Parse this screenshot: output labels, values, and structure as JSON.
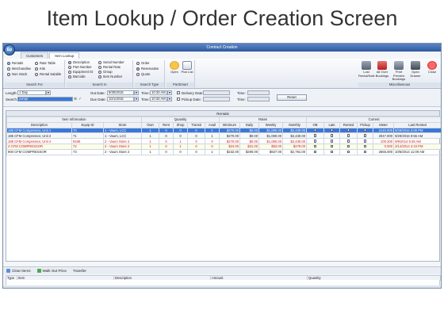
{
  "slide_title": "Item Lookup / Order Creation Screen",
  "window": {
    "title": "Contract Creation",
    "logo": "Ep"
  },
  "tabs": [
    {
      "label": "Customers"
    },
    {
      "label": "Item Lookup"
    }
  ],
  "ribbon": {
    "search_for": {
      "title": "Search For",
      "options": [
        "Rentals",
        "Merchandise",
        "Non Stock",
        "Rate Table",
        "Kits",
        "Rental Salable"
      ],
      "selected": "Rentals"
    },
    "search_in": {
      "title": "Search In",
      "options": [
        "Description",
        "Part Number",
        "Equipment ID",
        "Barcode",
        "Serial Number",
        "Rental Rate",
        "Group",
        "Item Number"
      ],
      "selected": "Description"
    },
    "search_type": {
      "title": "Search Type",
      "options": [
        "Order",
        "Reservation",
        "Quote"
      ],
      "selected": "Reservation"
    },
    "part_smart": {
      "title": "PartSmart",
      "buttons": [
        "Open",
        "Pick List"
      ]
    },
    "misc": {
      "title": "Miscellaneous",
      "buttons": [
        "Lost Rental/Sale",
        "All Over Bookings",
        "Print Preview Bookings",
        "Open Drawer",
        "Close"
      ]
    }
  },
  "form": {
    "length_label": "Length:",
    "length_value": "1 Day",
    "search_label": "Search:",
    "search_value": "compr",
    "out_date_label": "Out Date:",
    "out_date_value": "9/30/2015",
    "due_date_label": "Due Date:",
    "due_date_value": "10/1/2015",
    "time_label": "Time:",
    "out_time": "10:33 AM",
    "due_time": "10:33 AM",
    "delivery_label": "Delivery Date:",
    "pickup_label": "Pickup Date:",
    "reset_label": "Reset"
  },
  "grid": {
    "caption": "Rentals",
    "group_headers": [
      "Item Information",
      "Quantity",
      "Rates",
      "Current"
    ],
    "columns": [
      "Description",
      "Equip ID",
      "Store",
      "Own",
      "Rent",
      "Shop",
      "Transit",
      "Avail",
      "Minimum",
      "Daily",
      "Weekly",
      "Monthly",
      "OB",
      "Late",
      "Rented",
      "Pickup",
      "Meter",
      "Last Rented"
    ],
    "rows": [
      {
        "cells": [
          "185 CFM Compressor, Unit 1",
          "70",
          "1 - Vaum, LCC",
          "1",
          "0",
          "0",
          "0",
          "1",
          "$270.00",
          "$0.00",
          "$1,080.00",
          "$2,430.00",
          "",
          "",
          "",
          "",
          "2140.000",
          "9/29/2015 3:00 PM"
        ],
        "style": "sel"
      },
      {
        "cells": [
          "185 CFM Compressor, Unit 2",
          "71",
          "1 - Vaum, LCC",
          "1",
          "0",
          "0",
          "0",
          "1",
          "$270.00",
          "$0.00",
          "$1,080.00",
          "$2,430.00",
          "",
          "",
          "",
          "",
          "2047.000",
          "9/29/2015 9:55 AM"
        ],
        "style": "alt"
      },
      {
        "cells": [
          "185 CFM Compressor, Unit 4",
          "9168",
          "2 - Vaum Store 2",
          "1",
          "0",
          "1",
          "0",
          "0",
          "$270.00",
          "$0.00",
          "$1,080.00",
          "$2,430.00",
          "",
          "",
          "",
          "",
          "100.200",
          "9/9/2014 9:45 AM"
        ],
        "style": "red"
      },
      {
        "cells": [
          "4 CFM COMPRESSOR",
          "72",
          "2 - Vaum Store 2",
          "1",
          "0",
          "1",
          "0",
          "0",
          "$24.00",
          "$31.00",
          "$93.00",
          "$278.00",
          "",
          "",
          "",
          "",
          "0.000",
          "2/14/2014 4:43 PM"
        ],
        "style": "red2"
      },
      {
        "cells": [
          "900 CFM COMPRESSOR",
          "73",
          "2 - Vaum Store 2",
          "1",
          "0",
          "0",
          "0",
          "1",
          "$232.00",
          "$290.00",
          "$927.00",
          "$2,781.00",
          "",
          "",
          "",
          "",
          "2655.000",
          "10/6/2014 11:09 AM"
        ],
        "style": ""
      }
    ]
  },
  "bottom_toolbar": {
    "clear_items": "Clear Items",
    "walk_out_price": "Walk Out Price",
    "transfer": "Transfer"
  },
  "order_table": {
    "columns": [
      "Type",
      "Item",
      "Description",
      "Amount",
      "Quantity"
    ]
  }
}
